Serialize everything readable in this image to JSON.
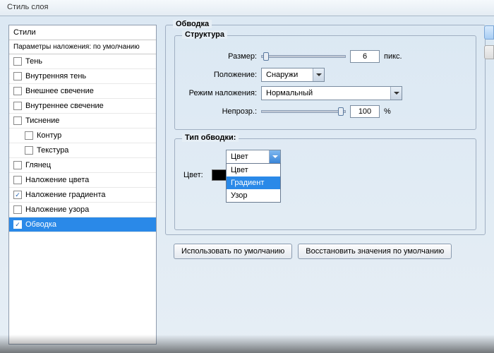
{
  "window": {
    "title": "Стиль слоя"
  },
  "left": {
    "header": "Стили",
    "blendRow": "Параметры наложения: по умолчанию",
    "items": [
      {
        "label": "Тень",
        "checked": false,
        "indent": false
      },
      {
        "label": "Внутренняя тень",
        "checked": false,
        "indent": false
      },
      {
        "label": "Внешнее свечение",
        "checked": false,
        "indent": false
      },
      {
        "label": "Внутреннее свечение",
        "checked": false,
        "indent": false
      },
      {
        "label": "Тиснение",
        "checked": false,
        "indent": false
      },
      {
        "label": "Контур",
        "checked": false,
        "indent": true
      },
      {
        "label": "Текстура",
        "checked": false,
        "indent": true
      },
      {
        "label": "Глянец",
        "checked": false,
        "indent": false
      },
      {
        "label": "Наложение цвета",
        "checked": false,
        "indent": false
      },
      {
        "label": "Наложение градиента",
        "checked": true,
        "indent": false
      },
      {
        "label": "Наложение узора",
        "checked": false,
        "indent": false
      },
      {
        "label": "Обводка",
        "checked": true,
        "indent": false,
        "selected": true
      }
    ]
  },
  "stroke": {
    "legend": "Обводка",
    "struct": {
      "legend": "Структура",
      "sizeLabel": "Размер:",
      "sizeValue": "6",
      "sizeUnit": "пикс.",
      "posLabel": "Положение:",
      "posValue": "Снаружи",
      "blendLabel": "Режим наложения:",
      "blendValue": "Нормальный",
      "opacityLabel": "Непрозр.:",
      "opacityValue": "100",
      "opacityUnit": "%"
    },
    "type": {
      "legend": "Тип обводки:",
      "value": "Цвет",
      "options": [
        "Цвет",
        "Градиент",
        "Узор"
      ],
      "highlighted": "Градиент",
      "colorLabel": "Цвет:",
      "colorHex": "#000000"
    }
  },
  "buttons": {
    "useDefault": "Использовать по умолчанию",
    "resetDefault": "Восстановить значения по умолчанию"
  }
}
